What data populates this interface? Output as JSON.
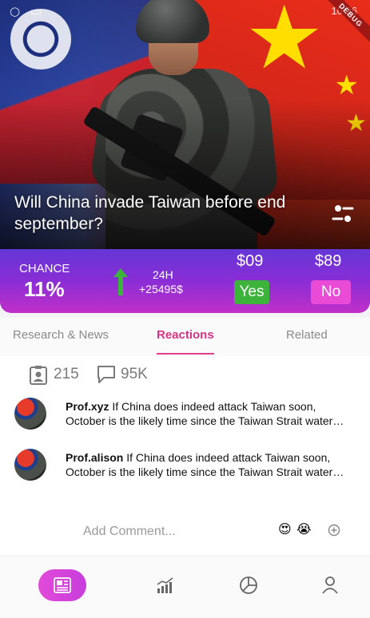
{
  "status_bar": {
    "time": "10:26",
    "debug_banner": "DEBUG"
  },
  "market": {
    "question": "Will China invade Taiwan before end september?",
    "chance_label": "CHANCE",
    "chance_value": "11%",
    "period_label": "24H",
    "period_volume": "+25495$",
    "yes_price": "$09",
    "no_price": "$89",
    "yes_label": "Yes",
    "no_label": "No"
  },
  "tabs": [
    {
      "label": "Research & News",
      "active": false
    },
    {
      "label": "Reactions",
      "active": true
    },
    {
      "label": "Related",
      "active": false
    }
  ],
  "stats": {
    "participants": "215",
    "comments": "95K"
  },
  "comments": [
    {
      "author": "Prof.xyz",
      "text": "If China does indeed attack Taiwan soon,",
      "line2": "October is the likely time since the Taiwan Strait water…"
    },
    {
      "author": "Prof.alison",
      "text": "If China does indeed attack Taiwan soon,",
      "line2": "October is the likely time since the Taiwan Strait water…"
    }
  ],
  "add_comment": {
    "placeholder": "Add Comment...",
    "emoji_1": "😍",
    "emoji_2": "😭"
  },
  "nav": {
    "items": [
      "news-icon",
      "chart-icon",
      "pie-chart-icon",
      "profile-icon"
    ]
  },
  "colors": {
    "accent": "#d63384",
    "yes": "#3cb43c",
    "no": "#e94bd6",
    "band_top": "#6436d6",
    "band_bottom": "#c130c8"
  }
}
